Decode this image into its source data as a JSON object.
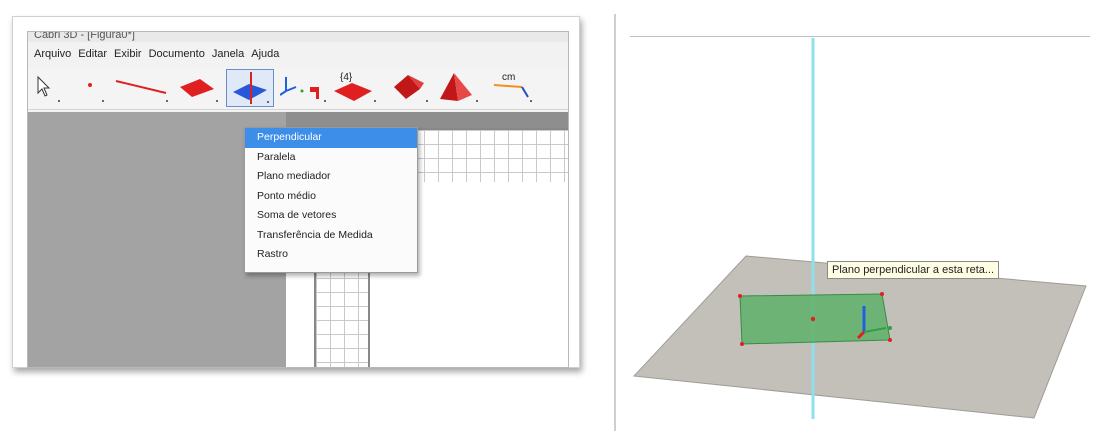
{
  "window": {
    "title": "Cabri 3D - [Figura0*]"
  },
  "menu": [
    "Arquivo",
    "Editar",
    "Exibir",
    "Documento",
    "Janela",
    "Ajuda"
  ],
  "toolbar": {
    "tools": [
      {
        "icon": "pointer-icon"
      },
      {
        "icon": "point-icon"
      },
      {
        "icon": "line-icon"
      },
      {
        "icon": "plane-icon"
      },
      {
        "icon": "perpendicular-tool-icon"
      },
      {
        "icon": "axes-icon"
      },
      {
        "icon": "polygon-icon"
      },
      {
        "icon": "polyhedron-icon"
      },
      {
        "icon": "pyramid-icon"
      },
      {
        "icon": "measure-icon"
      }
    ],
    "polygon_label": "{4}",
    "measure_label": "cm"
  },
  "dropdown": {
    "items": [
      "Perpendicular",
      "Paralela",
      "Plano mediador",
      "Ponto médio",
      "Soma de vetores",
      "Transferência de Medida",
      "Rastro"
    ],
    "selected_index": 0
  },
  "view3d": {
    "tooltip": "Plano perpendicular a esta reta..."
  },
  "colors": {
    "selection": "#3d8ee8",
    "tool_red": "#e02020",
    "ground_plane": "#c2c0b8",
    "green_plane": "#5fb06a",
    "cyan_line": "#8ee0ec",
    "canvas_gray": "#a3a3a3"
  }
}
